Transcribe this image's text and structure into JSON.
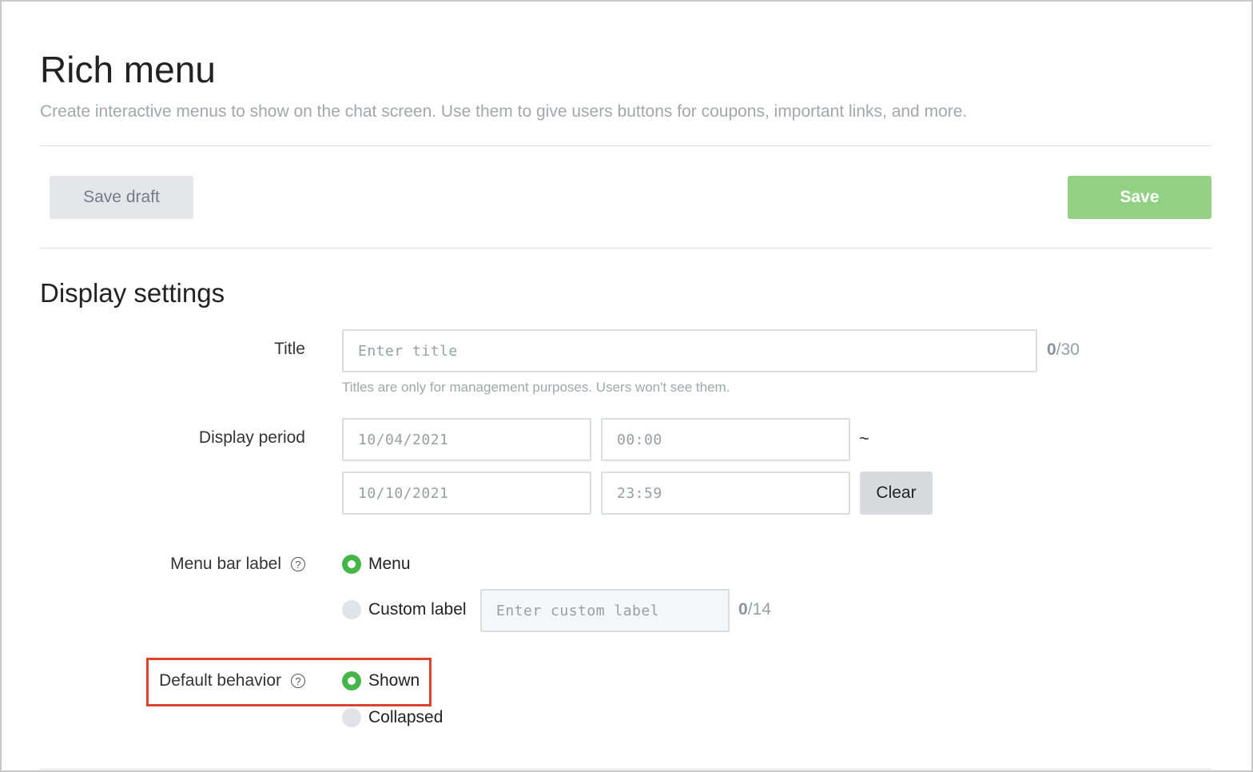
{
  "header": {
    "title": "Rich menu",
    "description": "Create interactive menus to show on the chat screen. Use them to give users buttons for coupons, important links, and more."
  },
  "toolbar": {
    "save_draft_label": "Save draft",
    "save_label": "Save"
  },
  "display_settings": {
    "section_title": "Display settings",
    "title_field": {
      "label": "Title",
      "placeholder": "Enter title",
      "count_current": "0",
      "count_max": "/30",
      "hint": "Titles are only for management purposes. Users won't see them."
    },
    "display_period": {
      "label": "Display period",
      "start_date": "10/04/2021",
      "start_time": "00:00",
      "separator": "~",
      "end_date": "10/10/2021",
      "end_time": "23:59",
      "clear_label": "Clear"
    },
    "menu_bar_label": {
      "label": "Menu bar label",
      "help_icon": "?",
      "options": [
        {
          "label": "Menu",
          "selected": true
        },
        {
          "label": "Custom label",
          "selected": false
        }
      ],
      "custom_placeholder": "Enter custom label",
      "count_current": "0",
      "count_max": "/14"
    },
    "default_behavior": {
      "label": "Default behavior",
      "help_icon": "?",
      "options": [
        {
          "label": "Shown",
          "selected": true
        },
        {
          "label": "Collapsed",
          "selected": false
        }
      ]
    }
  },
  "colors": {
    "accent_green": "#45b649",
    "save_button": "#92d184",
    "highlight_border": "#e0412a"
  }
}
